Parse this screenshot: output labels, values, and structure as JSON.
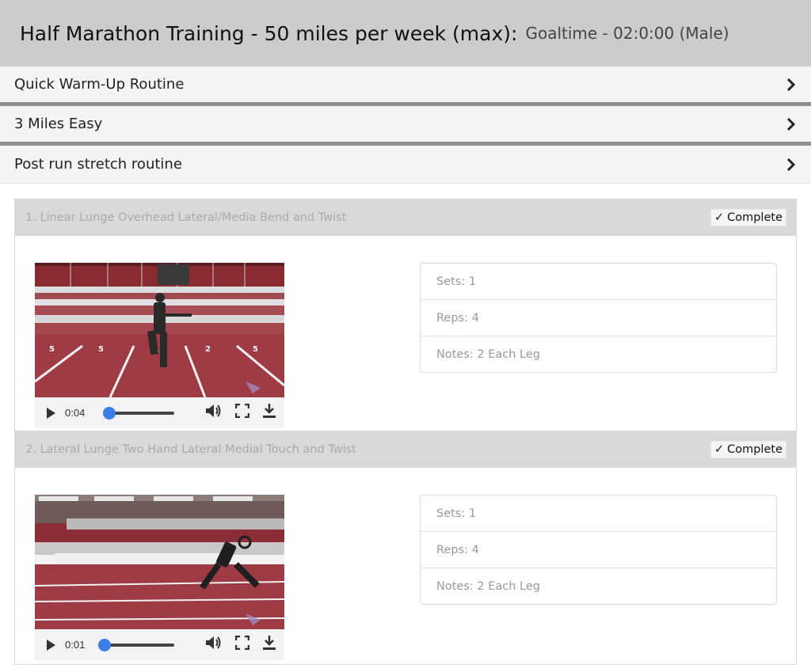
{
  "header": {
    "title": "Half Marathon Training - 50 miles per week (max):",
    "subtitle": "Goaltime - 02:0:00 (Male)"
  },
  "accordion": [
    {
      "label": "Quick Warm-Up Routine",
      "icon": "chevron-right-icon"
    },
    {
      "label": "3 Miles Easy",
      "icon": "chevron-right-icon"
    },
    {
      "label": "Post run stretch routine",
      "icon": "chevron-right-icon"
    }
  ],
  "exercises": [
    {
      "title": "1. Linear Lunge Overhead Lateral/Media Bend and Twist",
      "complete_label": "Complete",
      "video": {
        "time": "0:04",
        "progress": 0.12
      },
      "sets": "Sets: 1",
      "reps": "Reps: 4",
      "notes": "Notes: 2 Each Leg"
    },
    {
      "title": "2. Lateral Lunge Two Hand Lateral Medial Touch and Twist",
      "complete_label": "Complete",
      "video": {
        "time": "0:01",
        "progress": 0.03
      },
      "sets": "Sets: 1",
      "reps": "Reps: 4",
      "notes": "Notes: 2 Each Leg"
    }
  ],
  "colors": {
    "header_bg": "#cccccc",
    "accordion_bg": "#f4f4f4",
    "accordion_divider": "#8f8f8f",
    "exercise_head_bg": "#d9d9d9",
    "track_color": "#9e3b45",
    "video_knob": "#3b7ee8"
  }
}
